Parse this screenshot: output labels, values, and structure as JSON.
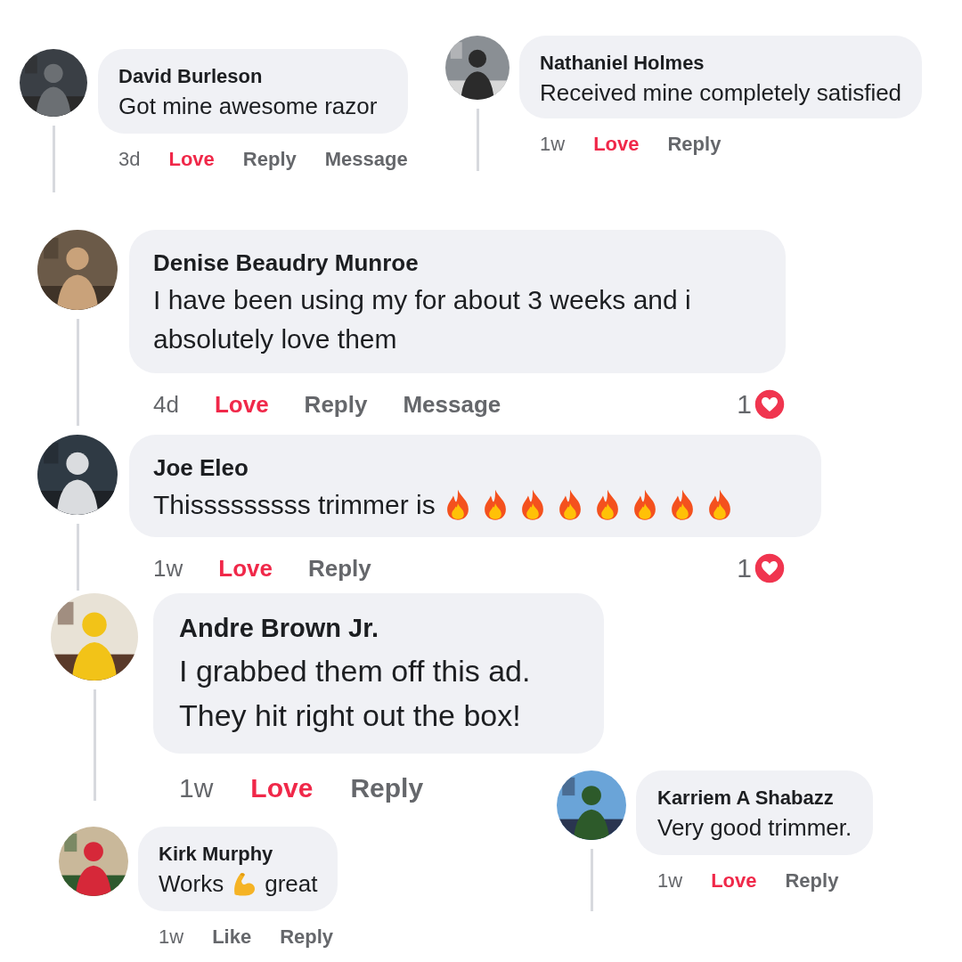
{
  "comments": [
    {
      "author": "David Burleson",
      "body": [
        {
          "kind": "text",
          "text": "Got mine awesome razor"
        }
      ],
      "time": "3d",
      "reaction": {
        "label": "Love",
        "selected": true
      },
      "actions": [
        "Reply",
        "Message"
      ]
    },
    {
      "author": "Nathaniel Holmes",
      "body": [
        {
          "kind": "text",
          "text": "Received mine completely satisfied"
        }
      ],
      "time": "1w",
      "reaction": {
        "label": "Love",
        "selected": true
      },
      "actions": [
        "Reply"
      ]
    },
    {
      "author": "Denise Beaudry Munroe",
      "body": [
        {
          "kind": "text",
          "text": "I have been using my for about 3 weeks and i absolutely love them"
        }
      ],
      "time": "4d",
      "reaction": {
        "label": "Love",
        "selected": true
      },
      "actions": [
        "Reply",
        "Message"
      ],
      "reaction_count": "1"
    },
    {
      "author": "Joe Eleo",
      "body": [
        {
          "kind": "text",
          "text": "Thisssssssss trimmer is"
        },
        {
          "kind": "fire"
        },
        {
          "kind": "fire"
        },
        {
          "kind": "fire"
        },
        {
          "kind": "fire"
        },
        {
          "kind": "fire"
        },
        {
          "kind": "fire"
        },
        {
          "kind": "fire"
        },
        {
          "kind": "fire"
        }
      ],
      "time": "1w",
      "reaction": {
        "label": "Love",
        "selected": true
      },
      "actions": [
        "Reply"
      ],
      "reaction_count": "1"
    },
    {
      "author": "Andre Brown Jr.",
      "body": [
        {
          "kind": "text",
          "text": "I grabbed them off this ad."
        },
        {
          "kind": "break"
        },
        {
          "kind": "text",
          "text": "They hit right out the box!"
        }
      ],
      "time": "1w",
      "reaction": {
        "label": "Love",
        "selected": true
      },
      "actions": [
        "Reply"
      ]
    },
    {
      "author": "Karriem A Shabazz",
      "body": [
        {
          "kind": "text",
          "text": "Very good trimmer."
        }
      ],
      "time": "1w",
      "reaction": {
        "label": "Love",
        "selected": true
      },
      "actions": [
        "Reply"
      ]
    },
    {
      "author": "Kirk Murphy",
      "body": [
        {
          "kind": "text",
          "text": "Works"
        },
        {
          "kind": "flex"
        },
        {
          "kind": "text",
          "text": "great"
        }
      ],
      "time": "1w",
      "reaction": {
        "label": "Like",
        "selected": false
      },
      "actions": [
        "Reply"
      ]
    }
  ]
}
